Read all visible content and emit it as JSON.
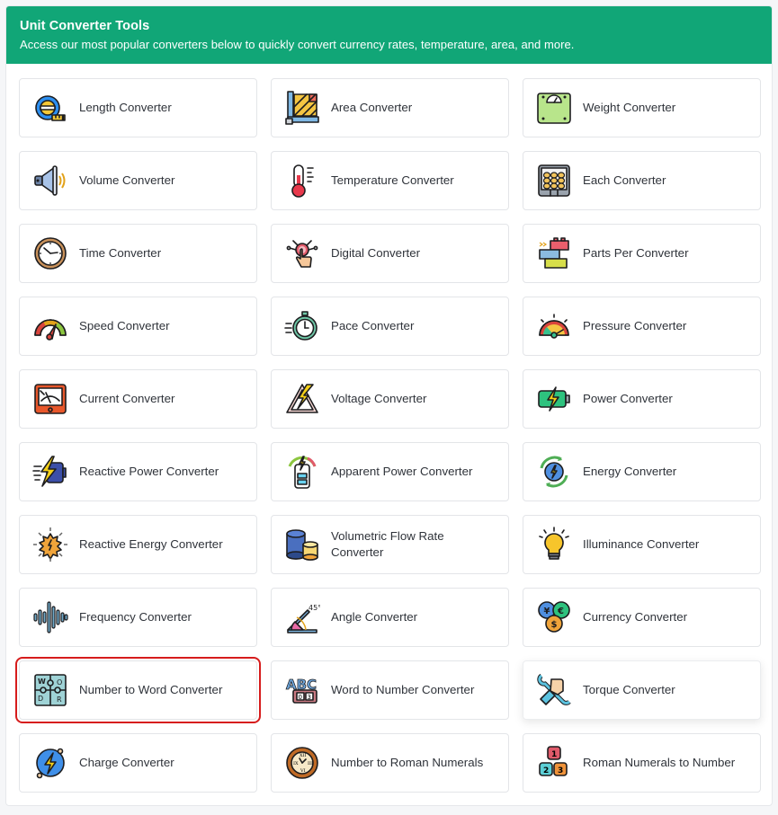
{
  "header": {
    "title": "Unit Converter Tools",
    "subtitle": "Access our most popular converters below to quickly convert currency rates, temperature, area, and more."
  },
  "theme": {
    "header_bg": "#11a677",
    "selected_outline": "#d61c1c"
  },
  "converters": [
    {
      "label": "Length Converter",
      "icon": "tape-measure-icon"
    },
    {
      "label": "Area Converter",
      "icon": "area-ruler-icon"
    },
    {
      "label": "Weight Converter",
      "icon": "weighing-scale-icon"
    },
    {
      "label": "Volume Converter",
      "icon": "speaker-volume-icon"
    },
    {
      "label": "Temperature Converter",
      "icon": "thermometer-icon"
    },
    {
      "label": "Each Converter",
      "icon": "egg-tray-icon"
    },
    {
      "label": "Time Converter",
      "icon": "clock-icon"
    },
    {
      "label": "Digital Converter",
      "icon": "touch-tap-icon"
    },
    {
      "label": "Parts Per Converter",
      "icon": "building-blocks-icon"
    },
    {
      "label": "Speed Converter",
      "icon": "speedometer-icon"
    },
    {
      "label": "Pace Converter",
      "icon": "stopwatch-icon"
    },
    {
      "label": "Pressure Converter",
      "icon": "pressure-gauge-icon"
    },
    {
      "label": "Current Converter",
      "icon": "ammeter-icon"
    },
    {
      "label": "Voltage Converter",
      "icon": "high-voltage-warning-icon"
    },
    {
      "label": "Power Converter",
      "icon": "battery-charge-icon"
    },
    {
      "label": "Reactive Power Converter",
      "icon": "fast-charge-battery-icon"
    },
    {
      "label": "Apparent Power Converter",
      "icon": "power-meter-icon"
    },
    {
      "label": "Energy Converter",
      "icon": "renewable-energy-icon"
    },
    {
      "label": "Reactive Energy Converter",
      "icon": "energy-burst-icon"
    },
    {
      "label": "Volumetric Flow Rate Converter",
      "icon": "cylinders-icon"
    },
    {
      "label": "Illuminance Converter",
      "icon": "light-bulb-icon"
    },
    {
      "label": "Frequency Converter",
      "icon": "sound-wave-icon"
    },
    {
      "label": "Angle Converter",
      "icon": "angle-icon"
    },
    {
      "label": "Currency Converter",
      "icon": "currency-coins-icon"
    },
    {
      "label": "Number to Word Converter",
      "icon": "word-puzzle-icon",
      "selected": true
    },
    {
      "label": "Word to Number Converter",
      "icon": "abc-counter-icon"
    },
    {
      "label": "Torque Converter",
      "icon": "wrench-hand-icon",
      "hovered": true
    },
    {
      "label": "Charge Converter",
      "icon": "electric-charge-icon"
    },
    {
      "label": "Number to Roman Numerals",
      "icon": "roman-clock-icon"
    },
    {
      "label": "Roman Numerals to Number",
      "icon": "number-blocks-icon"
    }
  ]
}
